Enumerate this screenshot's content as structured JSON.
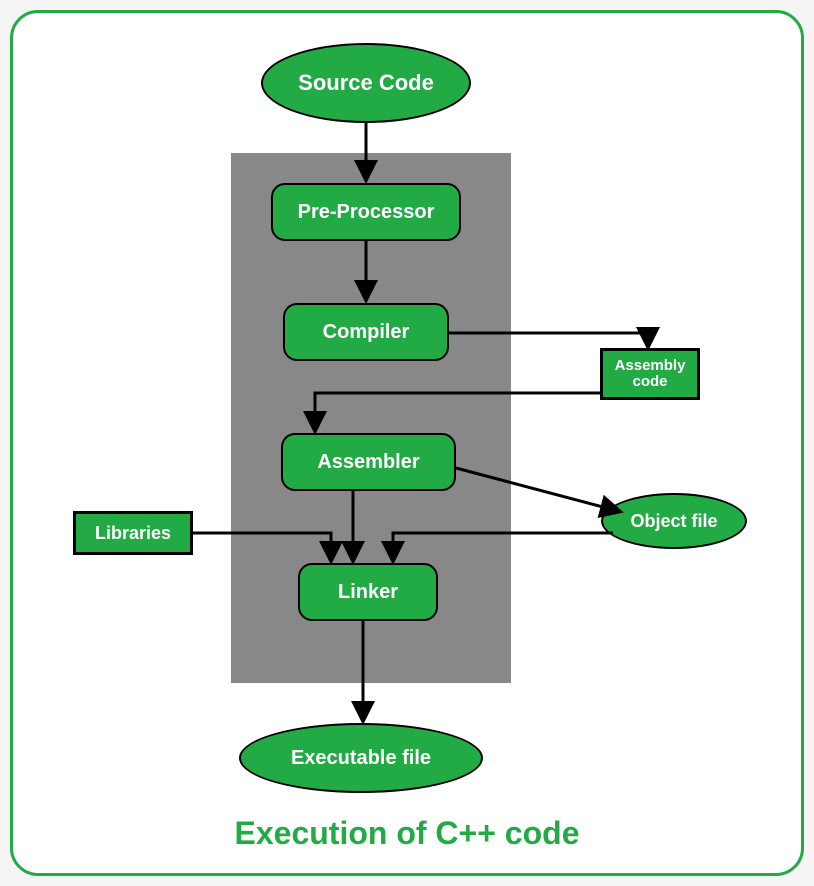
{
  "nodes": {
    "source": "Source Code",
    "preprocessor": "Pre-Processor",
    "compiler": "Compiler",
    "assembler": "Assembler",
    "linker": "Linker",
    "executable": "Executable file",
    "assembly_code": "Assembly\ncode",
    "object_file": "Object file",
    "libraries": "Libraries"
  },
  "caption": "Execution of C++ code"
}
